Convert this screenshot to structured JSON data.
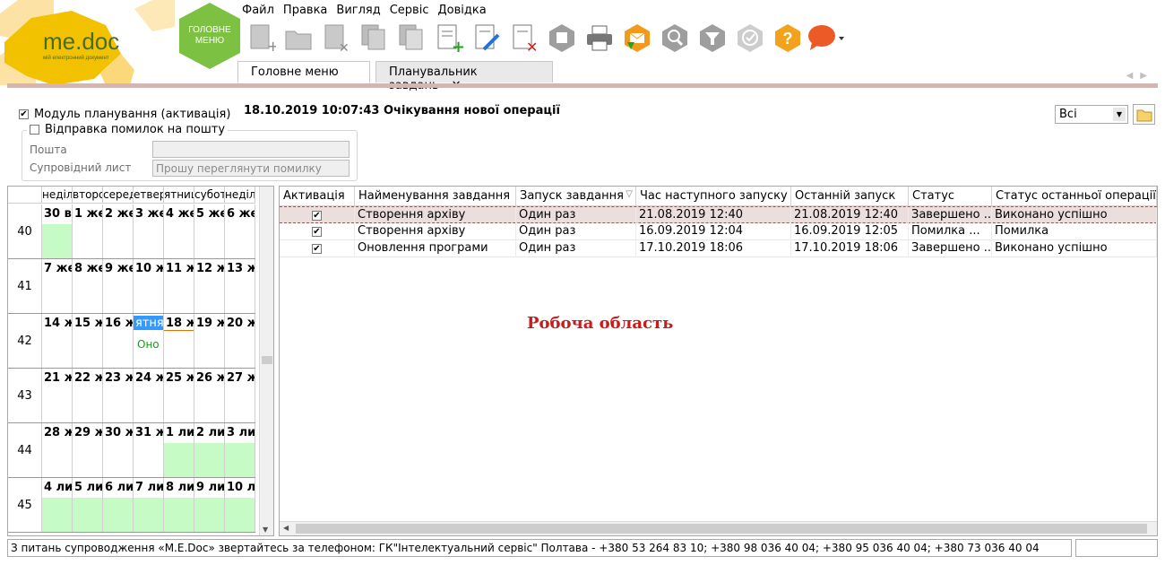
{
  "logo": {
    "brand": "me.doc",
    "tagline": "мій електронний документ"
  },
  "main_menu_button": {
    "line1": "ГОЛОВНЕ",
    "line2": "МЕНЮ"
  },
  "menu": [
    "Файл",
    "Правка",
    "Вигляд",
    "Сервіс",
    "Довідка"
  ],
  "toolbar_icons": [
    "new-doc-icon",
    "open-folder-icon",
    "delete-doc-icon",
    "copy-doc-icon",
    "copy-doc-2-icon",
    "add-doc-icon",
    "edit-doc-icon",
    "remove-doc-icon",
    "archive-icon",
    "print-icon",
    "send-mail-icon",
    "search-icon",
    "filter-icon",
    "check-icon",
    "help-icon",
    "chat-icon"
  ],
  "tabs": [
    {
      "label": "Головне меню",
      "active": false
    },
    {
      "label": "Планувальник завдань",
      "active": true,
      "close": "✕"
    }
  ],
  "options": {
    "planning_module": {
      "label": "Модуль планування (активація)",
      "checked": true
    },
    "error_mail": {
      "label": "Відправка помилок на пошту",
      "checked": false
    },
    "email_label": "Пошта",
    "email_value": "",
    "cover_letter_label": "Супровідний лист",
    "cover_letter_placeholder": "Прошу переглянути помилку"
  },
  "status_line": "18.10.2019 10:07:43 Очікування нової операції",
  "filter_select": {
    "value": "Всі"
  },
  "calendar": {
    "weekdays": [
      "неділ",
      "второ",
      "середа",
      "етвер",
      "ятниц",
      "субота",
      "неділя"
    ],
    "weeks": [
      {
        "num": "40",
        "days": [
          {
            "label": "30 в",
            "green": true
          },
          {
            "label": "1 же"
          },
          {
            "label": "2 же"
          },
          {
            "label": "3 же"
          },
          {
            "label": "4 же"
          },
          {
            "label": "5 же"
          },
          {
            "label": "6 же"
          }
        ]
      },
      {
        "num": "41",
        "days": [
          {
            "label": "7 же"
          },
          {
            "label": "8 же"
          },
          {
            "label": "9 же"
          },
          {
            "label": "10 ж"
          },
          {
            "label": "11 ж"
          },
          {
            "label": "12 ж"
          },
          {
            "label": "13 ж"
          }
        ]
      },
      {
        "num": "42",
        "days": [
          {
            "label": "14 ж"
          },
          {
            "label": "15 ж"
          },
          {
            "label": "16 ж"
          },
          {
            "label": "ятня",
            "selected": true,
            "event": "Оно"
          },
          {
            "label": "18 ж",
            "today": true
          },
          {
            "label": "19 ж"
          },
          {
            "label": "20 ж"
          }
        ]
      },
      {
        "num": "43",
        "days": [
          {
            "label": "21 ж"
          },
          {
            "label": "22 ж"
          },
          {
            "label": "23 ж"
          },
          {
            "label": "24 ж"
          },
          {
            "label": "25 ж"
          },
          {
            "label": "26 ж"
          },
          {
            "label": "27 ж"
          }
        ]
      },
      {
        "num": "44",
        "days": [
          {
            "label": "28 ж"
          },
          {
            "label": "29 ж"
          },
          {
            "label": "30 ж"
          },
          {
            "label": "31 ж"
          },
          {
            "label": "1 ли",
            "green": true
          },
          {
            "label": "2 ли",
            "green": true
          },
          {
            "label": "3 ли",
            "green": true
          }
        ]
      },
      {
        "num": "45",
        "days": [
          {
            "label": "4 ли",
            "green": true
          },
          {
            "label": "5 ли",
            "green": true
          },
          {
            "label": "6 ли",
            "green": true
          },
          {
            "label": "7 ли",
            "green": true
          },
          {
            "label": "8 ли",
            "green": true
          },
          {
            "label": "9 ли",
            "green": true
          },
          {
            "label": "10 л",
            "green": true
          }
        ]
      }
    ]
  },
  "grid": {
    "columns": [
      "Активація",
      "Найменування завдання",
      "Запуск завдання",
      "Час наступного запуску",
      "Останній запуск",
      "Статус",
      "Статус останньої операції"
    ],
    "sort_indicator": "▽",
    "rows": [
      {
        "active": true,
        "name": "Створення архіву",
        "launch": "Один раз",
        "next": "21.08.2019 12:40",
        "last": "21.08.2019 12:40",
        "status": "Завершено ...",
        "last_status": "Виконано успішно",
        "selected": true
      },
      {
        "active": true,
        "name": "Створення архіву",
        "launch": "Один раз",
        "next": "16.09.2019 12:04",
        "last": "16.09.2019 12:05",
        "status": "Помилка    ...",
        "last_status": "Помилка"
      },
      {
        "active": true,
        "name": "Оновлення програми",
        "launch": "Один раз",
        "next": "17.10.2019 18:06",
        "last": "17.10.2019 18:06",
        "status": "Завершено ...",
        "last_status": "Виконано успішно"
      }
    ],
    "work_area_label": "Робоча область"
  },
  "statusbar": {
    "text": "З питань супроводження «M.E.Doc» звертайтесь за телефоном: ГК\"Інтелектуальний сервіс\" Полтава - +380 53 264 83 10; +380 98 036 40 04; +380 95 036 40 04; +380 73 036 40 04",
    "right": ""
  },
  "colors": {
    "brand_yellow": "#f2c200",
    "brand_green": "#7dc143",
    "accent_red": "#cc1a1a",
    "cal_green": "#c6fbc6",
    "selection_blue": "#3399ff"
  }
}
